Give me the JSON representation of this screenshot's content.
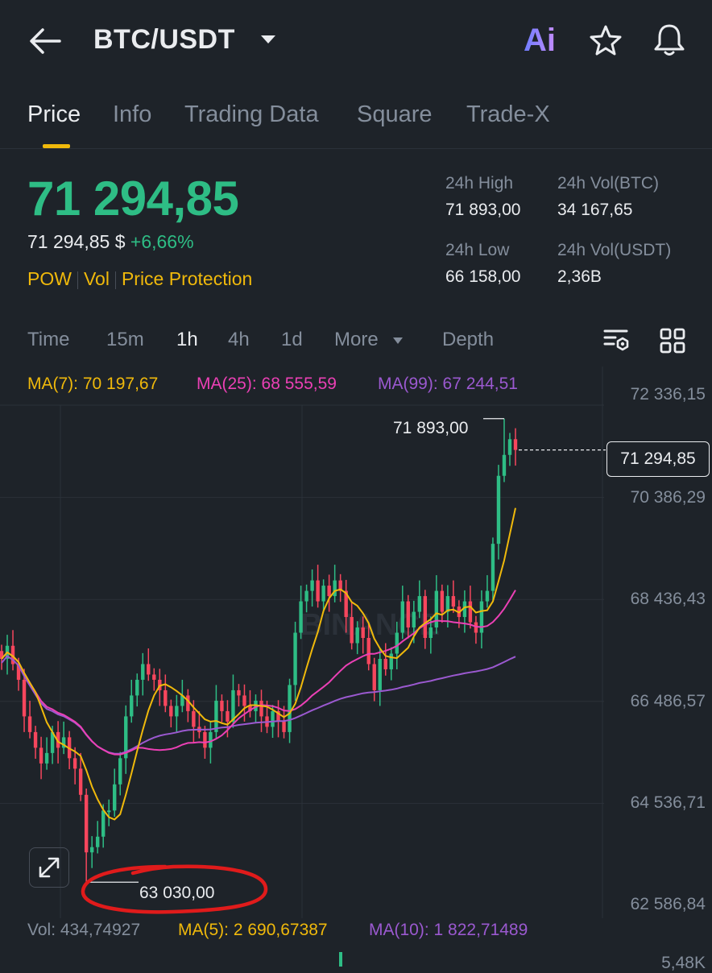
{
  "header": {
    "pair": "BTC/USDT",
    "ai_label": "Ai"
  },
  "tabs": [
    {
      "label": "Price",
      "active": true
    },
    {
      "label": "Info"
    },
    {
      "label": "Trading Data"
    },
    {
      "label": "Square"
    },
    {
      "label": "Trade-X"
    }
  ],
  "ticker": {
    "last_price": "71 294,85",
    "fiat_price": "71 294,85 $",
    "change": "+6,66%",
    "tags": [
      "POW",
      "Vol",
      "Price Protection"
    ],
    "stats": {
      "high_label": "24h High",
      "high": "71 893,00",
      "vol_btc_label": "24h Vol(BTC)",
      "vol_btc": "34 167,65",
      "low_label": "24h Low",
      "low": "66 158,00",
      "vol_usdt_label": "24h Vol(USDT)",
      "vol_usdt": "2,36B"
    }
  },
  "intervals": {
    "time": "Time",
    "m15": "15m",
    "h1": "1h",
    "h4": "4h",
    "d1": "1d",
    "more": "More",
    "depth": "Depth",
    "active": "1h"
  },
  "ma_legend": {
    "ma7": "MA(7): 70 197,67",
    "ma25": "MA(25): 68 555,59",
    "ma99": "MA(99): 67 244,51"
  },
  "price_axis": [
    "72 336,15",
    "70 386,29",
    "68 436,43",
    "66 486,57",
    "64 536,71",
    "62 586,84"
  ],
  "current_price_tag": "71 294,85",
  "high_marker": "71 893,00",
  "low_marker": "63 030,00",
  "watermark": "BINANCE",
  "volume_legend": {
    "vol": "Vol: 434,74927",
    "ma5": "MA(5): 2 690,67387",
    "ma10": "MA(10): 1 822,71489",
    "axis_top": "5,48K"
  },
  "colors": {
    "bg": "#1e2329",
    "up": "#2ebd85",
    "down": "#f6465d",
    "accent": "#f0b90b",
    "ma7": "#f0b90b",
    "ma25": "#eb40b5",
    "ma99": "#9b59d0",
    "annotation": "#e01b1b"
  },
  "chart_data": {
    "type": "candlestick",
    "interval": "1h",
    "y_axis_ticks": [
      72336.15,
      70386.29,
      68436.43,
      66486.57,
      64536.71,
      62586.84
    ],
    "ylim": [
      62400,
      72600
    ],
    "high": 71893.0,
    "low": 63030.0,
    "last": 71294.85,
    "close_path": [
      67300,
      67550,
      67200,
      66900,
      66200,
      65900,
      65600,
      65300,
      65500,
      65900,
      65600,
      65800,
      65400,
      65200,
      64700,
      63600,
      63700,
      63900,
      64400,
      64400,
      64900,
      65400,
      66200,
      66600,
      66900,
      67200,
      67000,
      66900,
      66700,
      66400,
      66200,
      66400,
      66600,
      66300,
      66000,
      65900,
      65600,
      65900,
      66500,
      66300,
      66100,
      66700,
      66600,
      66400,
      66300,
      66500,
      66200,
      66000,
      66300,
      66100,
      65900,
      66800,
      67800,
      68400,
      68600,
      68800,
      68400,
      68700,
      68500,
      68800,
      68600,
      68100,
      67600,
      67900,
      67700,
      67200,
      66700,
      67300,
      67100,
      67400,
      67800,
      68400,
      67900,
      68200,
      68500,
      67700,
      67900,
      68600,
      68200,
      68500,
      68300,
      68100,
      68400,
      68000,
      67800,
      68400,
      68600,
      69500,
      70800,
      71200,
      71500,
      71295
    ],
    "annotation": "Red hand-drawn circle around the 63 030,00 low marker"
  }
}
